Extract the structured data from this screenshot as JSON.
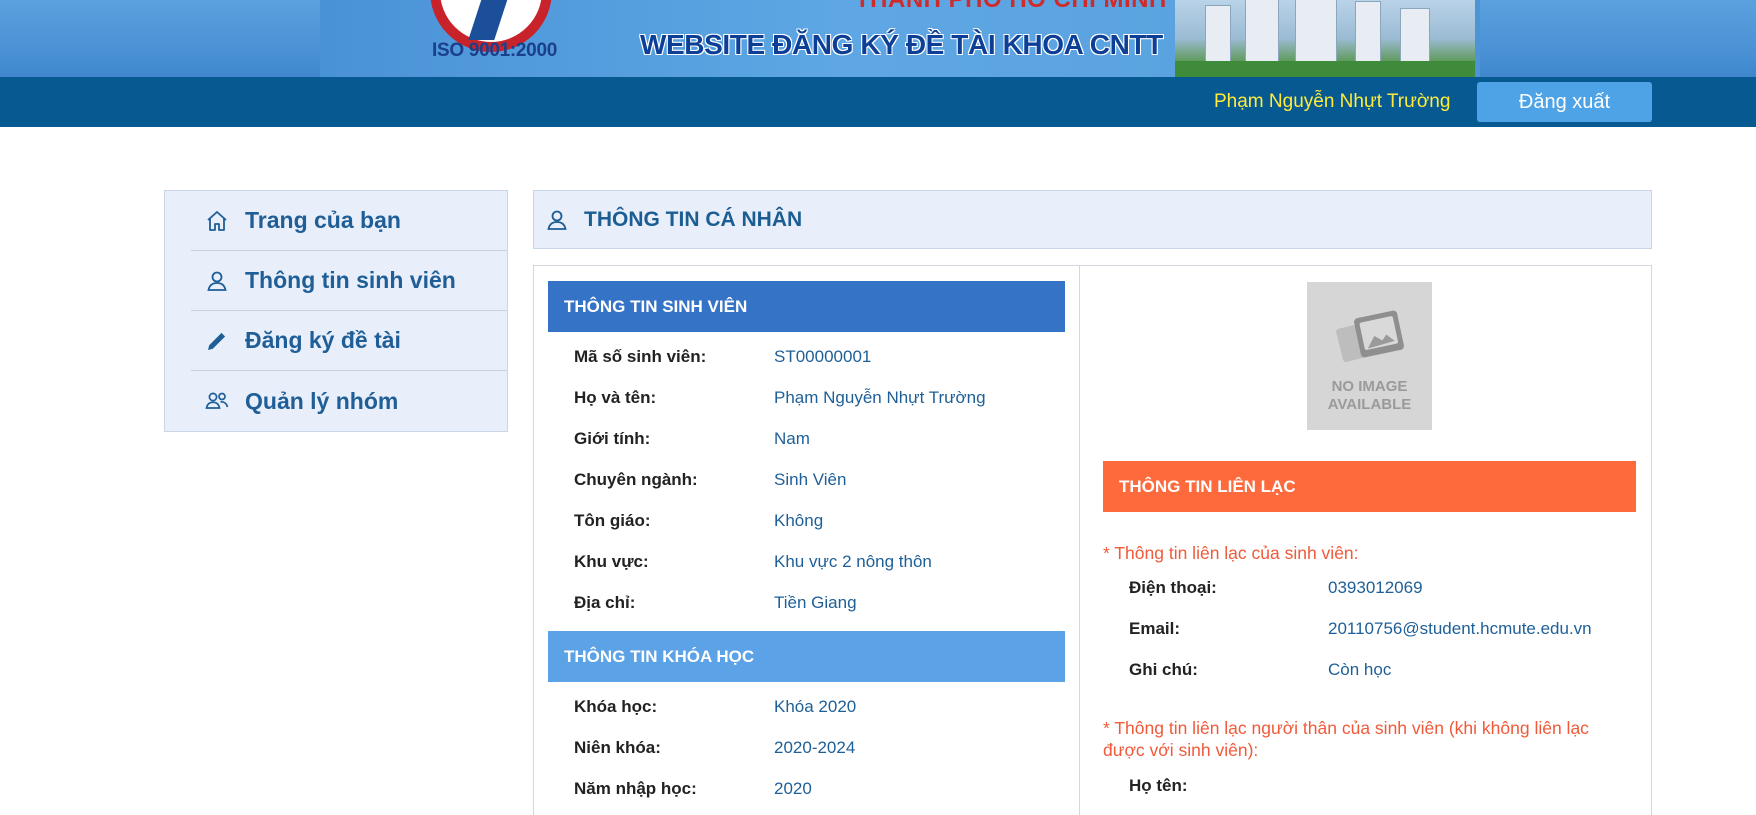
{
  "banner": {
    "city_text": "THÀNH PHỐ HỒ CHÍ MINH",
    "iso_text": "ISO 9001:2000",
    "site_title": "WEBSITE ĐĂNG KÝ ĐỀ TÀI KHOA CNTT"
  },
  "header": {
    "user_name": "Phạm Nguyễn Nhựt Trường",
    "logout_label": "Đăng xuất"
  },
  "sidebar": {
    "items": [
      {
        "label": "Trang của bạn",
        "icon": "home-icon"
      },
      {
        "label": "Thông tin sinh viên",
        "icon": "user-icon"
      },
      {
        "label": "Đăng ký đề tài",
        "icon": "pencil-icon"
      },
      {
        "label": "Quản lý nhóm",
        "icon": "users-icon"
      }
    ]
  },
  "main": {
    "title": "THÔNG TIN CÁ NHÂN",
    "student_section": {
      "title": "THÔNG TIN SINH VIÊN",
      "fields": [
        {
          "label": "Mã số sinh viên:",
          "value": "ST00000001"
        },
        {
          "label": "Họ và tên:",
          "value": "Phạm Nguyễn Nhựt Trường"
        },
        {
          "label": "Giới tính:",
          "value": "Nam"
        },
        {
          "label": "Chuyên ngành:",
          "value": "Sinh Viên"
        },
        {
          "label": "Tôn giáo:",
          "value": "Không"
        },
        {
          "label": "Khu vực:",
          "value": "Khu vực 2 nông thôn"
        },
        {
          "label": "Địa chỉ:",
          "value": "Tiền Giang"
        }
      ]
    },
    "course_section": {
      "title": "THÔNG TIN KHÓA HỌC",
      "fields": [
        {
          "label": "Khóa học:",
          "value": "Khóa 2020"
        },
        {
          "label": "Niên khóa:",
          "value": "2020-2024"
        },
        {
          "label": "Năm nhập học:",
          "value": "2020"
        }
      ]
    },
    "photo": {
      "no_image_line1": "NO IMAGE",
      "no_image_line2": "AVAILABLE"
    },
    "contact_section": {
      "title": "THÔNG TIN LIÊN LẠC",
      "student_note": "* Thông tin liên lạc của sinh viên:",
      "fields": [
        {
          "label": "Điện thoại:",
          "value": "0393012069"
        },
        {
          "label": "Email:",
          "value": "20110756@student.hcmute.edu.vn"
        },
        {
          "label": "Ghi chú:",
          "value": "Còn học"
        }
      ],
      "relative_note_line1": "* Thông tin liên lạc người thân của sinh viên (khi không liên lạc",
      "relative_note_line2": "được với sinh viên):",
      "relative_fields": [
        {
          "label": "Họ tên:",
          "value": ""
        }
      ]
    }
  },
  "colors": {
    "topbar": "#075a91",
    "username": "#ffeb3b",
    "logout_button": "#4ea3e6",
    "student_bar": "#3573c6",
    "course_bar": "#5ba2e6",
    "contact_bar": "#ff6a3d",
    "note_text": "#f05a3a",
    "value_text": "#1e5f98"
  }
}
